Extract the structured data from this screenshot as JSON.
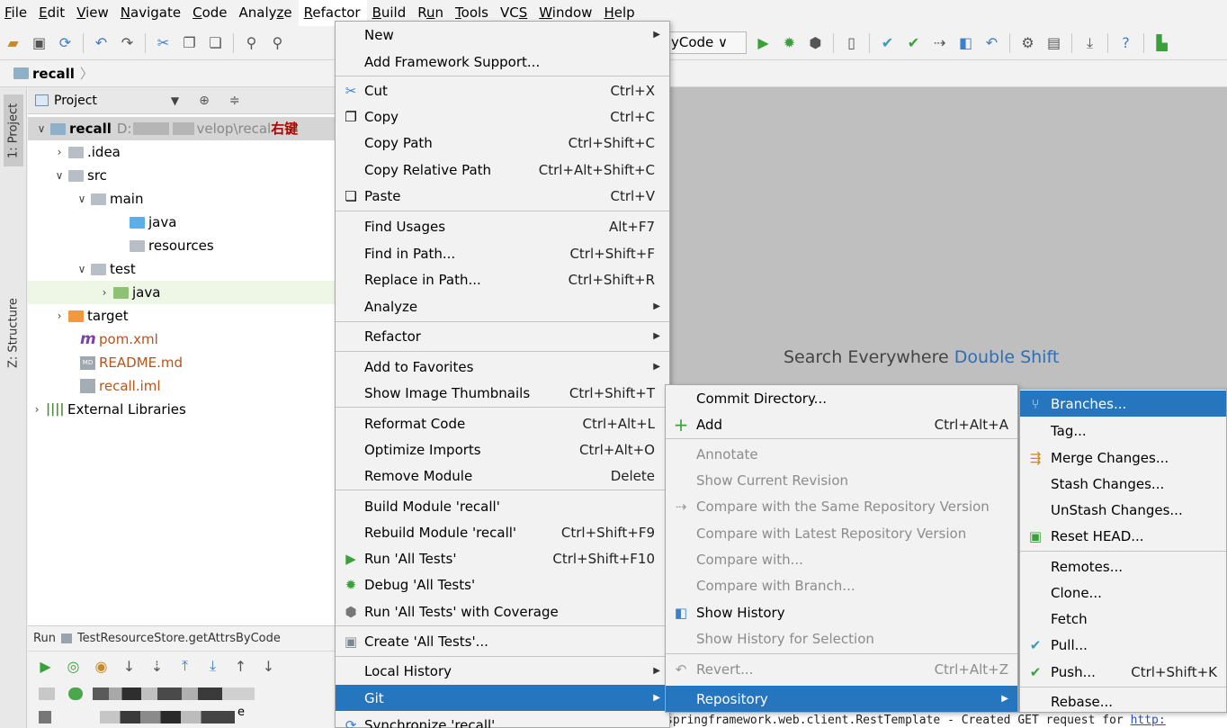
{
  "menubar": {
    "items": [
      {
        "label": "File",
        "u": "F",
        "rest": "ile"
      },
      {
        "label": "Edit",
        "u": "E",
        "rest": "dit"
      },
      {
        "label": "View",
        "u": "V",
        "rest": "iew"
      },
      {
        "label": "Navigate",
        "u": "N",
        "rest": "avigate"
      },
      {
        "label": "Code",
        "u": "C",
        "rest": "ode"
      },
      {
        "label": "Analyze",
        "pre": "Analy",
        "u": "z",
        "rest": "e"
      },
      {
        "label": "Refactor",
        "u": "R",
        "rest": "efactor"
      },
      {
        "label": "Build",
        "u": "B",
        "rest": "uild"
      },
      {
        "label": "Run",
        "pre": "R",
        "u": "u",
        "rest": "n"
      },
      {
        "label": "Tools",
        "u": "T",
        "rest": "ools"
      },
      {
        "label": "VCS",
        "pre": "VC",
        "u": "S",
        "rest": ""
      },
      {
        "label": "Window",
        "u": "W",
        "rest": "indow"
      },
      {
        "label": "Help",
        "u": "H",
        "rest": "elp"
      }
    ]
  },
  "toolbar": {
    "run_config": "yCode ∨"
  },
  "breadcrumb": {
    "project": "recall"
  },
  "sidebar": {
    "project_tab": "1: Project",
    "structure_tab": "Z: Structure"
  },
  "project_panel": {
    "title": "Project",
    "tree": [
      {
        "label": "recall",
        "path": "D:",
        "path2": "velop\\recal",
        "annotation": "右键"
      },
      {
        "label": ".idea"
      },
      {
        "label": "src"
      },
      {
        "label": "main"
      },
      {
        "label": "java"
      },
      {
        "label": "resources"
      },
      {
        "label": "test"
      },
      {
        "label": "java"
      },
      {
        "label": "target"
      },
      {
        "label": "pom.xml"
      },
      {
        "label": "README.md"
      },
      {
        "label": "recall.iml"
      },
      {
        "label": "External Libraries"
      }
    ]
  },
  "run_panel": {
    "title": "Run",
    "config": "TestResourceStore.getAttrsByCode",
    "frag": "e"
  },
  "editor": {
    "hint_text": "Search Everywhere",
    "hint_key": "Double Shift"
  },
  "console": {
    "text": "springframework.web.client.RestTemplate - Created GET request for ",
    "link": "http:"
  },
  "menu_main": {
    "items": [
      {
        "label": "New"
      },
      {
        "label": "Add Framework Support..."
      },
      {
        "label": "Cut",
        "shortcut": "Ctrl+X"
      },
      {
        "label": "Copy",
        "shortcut": "Ctrl+C"
      },
      {
        "label": "Copy Path",
        "shortcut": "Ctrl+Shift+C"
      },
      {
        "label": "Copy Relative Path",
        "shortcut": "Ctrl+Alt+Shift+C"
      },
      {
        "label": "Paste",
        "shortcut": "Ctrl+V"
      },
      {
        "label": "Find Usages",
        "shortcut": "Alt+F7"
      },
      {
        "label": "Find in Path...",
        "shortcut": "Ctrl+Shift+F"
      },
      {
        "label": "Replace in Path...",
        "shortcut": "Ctrl+Shift+R"
      },
      {
        "label": "Analyze"
      },
      {
        "label": "Refactor"
      },
      {
        "label": "Add to Favorites"
      },
      {
        "label": "Show Image Thumbnails",
        "shortcut": "Ctrl+Shift+T"
      },
      {
        "label": "Reformat Code",
        "shortcut": "Ctrl+Alt+L"
      },
      {
        "label": "Optimize Imports",
        "shortcut": "Ctrl+Alt+O"
      },
      {
        "label": "Remove Module",
        "shortcut": "Delete"
      },
      {
        "label": "Build Module 'recall'"
      },
      {
        "label": "Rebuild Module 'recall'",
        "shortcut": "Ctrl+Shift+F9"
      },
      {
        "label": "Run 'All Tests'",
        "shortcut": "Ctrl+Shift+F10"
      },
      {
        "label": "Debug 'All Tests'"
      },
      {
        "label": "Run 'All Tests' with Coverage"
      },
      {
        "label": "Create 'All Tests'..."
      },
      {
        "label": "Local History"
      },
      {
        "label": "Git"
      },
      {
        "label": "Synchronize 'recall'"
      }
    ]
  },
  "menu_git": {
    "items": [
      {
        "label": "Commit Directory..."
      },
      {
        "label": "Add",
        "shortcut": "Ctrl+Alt+A"
      },
      {
        "label": "Annotate"
      },
      {
        "label": "Show Current Revision"
      },
      {
        "label": "Compare with the Same Repository Version"
      },
      {
        "label": "Compare with Latest Repository Version"
      },
      {
        "label": "Compare with..."
      },
      {
        "label": "Compare with Branch..."
      },
      {
        "label": "Show History"
      },
      {
        "label": "Show History for Selection"
      },
      {
        "label": "Revert...",
        "shortcut": "Ctrl+Alt+Z"
      },
      {
        "label": "Repository"
      }
    ]
  },
  "menu_repo": {
    "items": [
      {
        "label": "Branches..."
      },
      {
        "label": "Tag..."
      },
      {
        "label": "Merge Changes..."
      },
      {
        "label": "Stash Changes..."
      },
      {
        "label": "UnStash Changes..."
      },
      {
        "label": "Reset HEAD..."
      },
      {
        "label": "Remotes..."
      },
      {
        "label": "Clone..."
      },
      {
        "label": "Fetch"
      },
      {
        "label": "Pull..."
      },
      {
        "label": "Push...",
        "shortcut": "Ctrl+Shift+K"
      },
      {
        "label": "Rebase..."
      }
    ]
  }
}
